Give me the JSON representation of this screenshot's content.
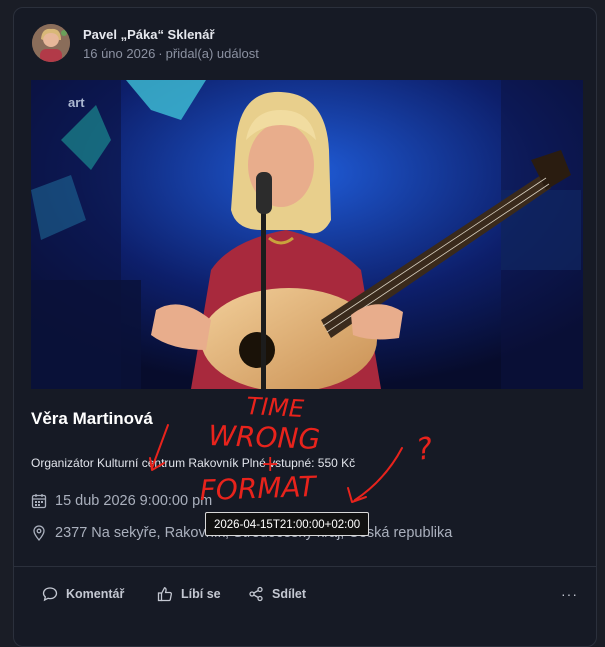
{
  "post": {
    "author": "Pavel „Páka“ Sklenář",
    "date": "16 úno 2026",
    "separator": "·",
    "action": "přidal(a) událost"
  },
  "hero": {
    "channel_logo": "art"
  },
  "event": {
    "title": "Věra Martinová",
    "description": "Organizátor Kulturní centrum Rakovník Plné vstupné: 550 Kč",
    "datetime": "15 dub 2026 9:00:00 pm",
    "datetime_tooltip": "2026-04-15T21:00:00+02:00",
    "location": "2377 Na sekyře, Rakovník, Středočeský kraj, Česká republika",
    "calendar_icon": "calendar-icon",
    "location_icon": "map-pin-icon"
  },
  "actions": {
    "comment": "Komentář",
    "like": "Líbí se",
    "share": "Sdílet",
    "more": "···"
  },
  "annotation": {
    "line1": "TIME",
    "line2": "WRONG",
    "plus": "+",
    "line3": "FORMAT",
    "mark": "?",
    "color": "#e8231c"
  }
}
